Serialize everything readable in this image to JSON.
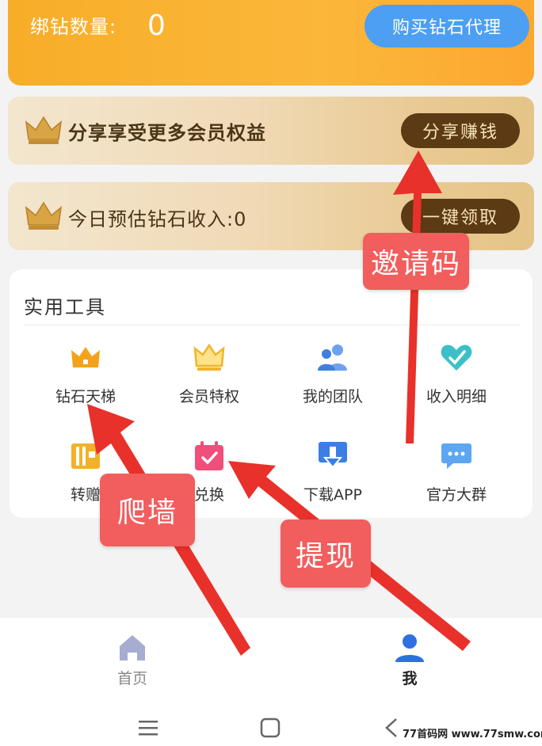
{
  "header": {
    "bound_diamonds_label": "绑钻数量:",
    "bound_diamonds_count": "0",
    "buy_agent_button": "购买钻石代理"
  },
  "banners": {
    "share": {
      "text": "分享享受更多会员权益",
      "button": "分享赚钱"
    },
    "income": {
      "text": "今日预估钻石收入:0",
      "button": "一键领取"
    }
  },
  "tools": {
    "title": "实用工具",
    "items": [
      {
        "label": "钻石天梯",
        "icon": "crown-orange-icon"
      },
      {
        "label": "会员特权",
        "icon": "crown-outline-icon"
      },
      {
        "label": "我的团队",
        "icon": "team-icon"
      },
      {
        "label": "收入明细",
        "icon": "heart-icon"
      },
      {
        "label": "转赠",
        "icon": "gift-ticket-icon"
      },
      {
        "label": "兑换",
        "icon": "calendar-check-icon"
      },
      {
        "label": "下载APP",
        "icon": "download-icon"
      },
      {
        "label": "官方大群",
        "icon": "chat-icon"
      }
    ]
  },
  "nav": {
    "home": "首页",
    "me": "我"
  },
  "annotations": {
    "invite": "邀请码",
    "climb": "爬墙",
    "withdraw": "提现"
  },
  "watermark": "77首码网 www.77smw.com",
  "colors": {
    "header_orange": "#f8ad28",
    "buy_button_blue": "#4c9ff2",
    "gold_button_brown": "#5b3a14",
    "annotation_red": "#f25d5d",
    "arrow_red": "#e8312a"
  }
}
